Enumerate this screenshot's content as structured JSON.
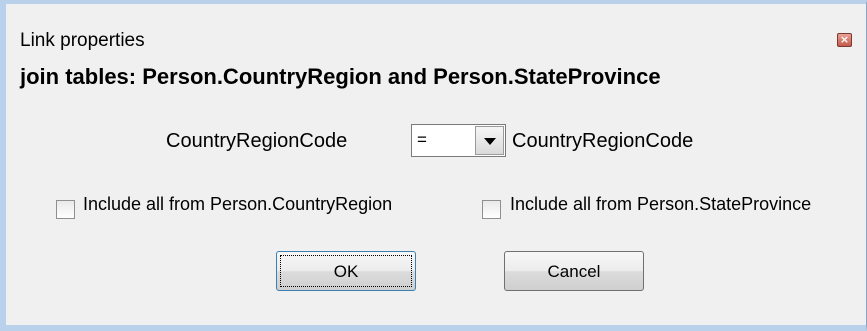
{
  "dialog": {
    "title": "Link properties",
    "close_icon": "close-icon",
    "heading": "join tables: Person.CountryRegion and Person.StateProvince"
  },
  "join": {
    "left_field": "CountryRegionCode",
    "operator": "=",
    "right_field": "CountryRegionCode"
  },
  "options": {
    "include_left_label": "Include all from Person.CountryRegion",
    "include_left_checked": false,
    "include_right_label": "Include all from Person.StateProvince",
    "include_right_checked": false
  },
  "buttons": {
    "ok_label": "OK",
    "cancel_label": "Cancel"
  },
  "colors": {
    "frame_border": "#b9d1ea",
    "dialog_bg": "#f0f0f0",
    "close_button": "#c45a4a"
  }
}
